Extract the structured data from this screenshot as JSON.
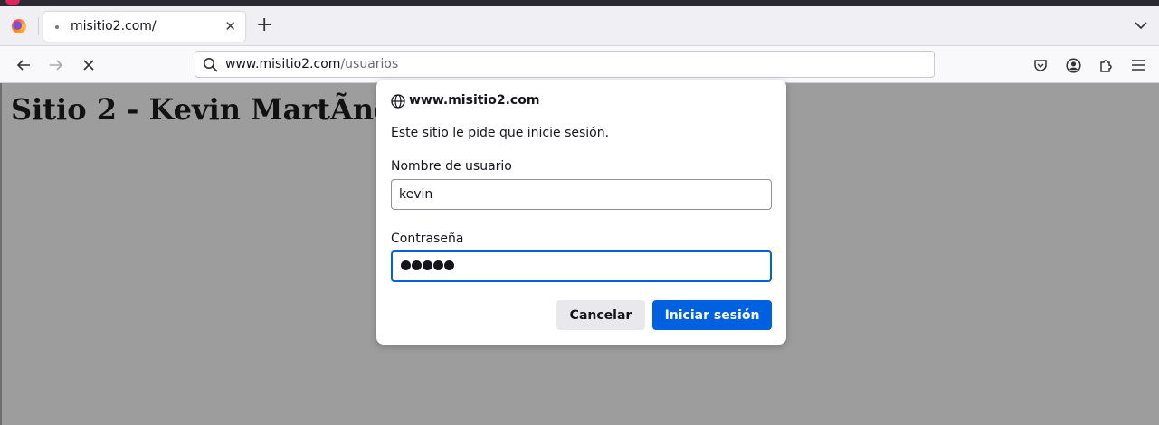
{
  "browser": {
    "tab": {
      "title": "misitio2.com/",
      "close_glyph": "✕"
    },
    "new_tab_glyph": "+",
    "url": {
      "host": "www.misitio2.com",
      "path": "/usuarios"
    }
  },
  "page": {
    "heading": "Sitio 2 - Kevin MartÃnez"
  },
  "auth_dialog": {
    "host": "www.misitio2.com",
    "message": "Este sitio le pide que inicie sesión.",
    "username_label": "Nombre de usuario",
    "username_value": "kevin",
    "password_label": "Contraseña",
    "password_length": 5,
    "cancel_label": "Cancelar",
    "login_label": "Iniciar sesión"
  },
  "colors": {
    "accent": "#0061e0",
    "content_bg": "#9d9d9d"
  },
  "icons": [
    "firefox-logo-icon",
    "back-arrow-icon",
    "forward-arrow-icon",
    "stop-icon",
    "search-icon",
    "pocket-icon",
    "account-icon",
    "extensions-icon",
    "menu-icon",
    "tab-list-chevron-icon",
    "globe-icon"
  ]
}
